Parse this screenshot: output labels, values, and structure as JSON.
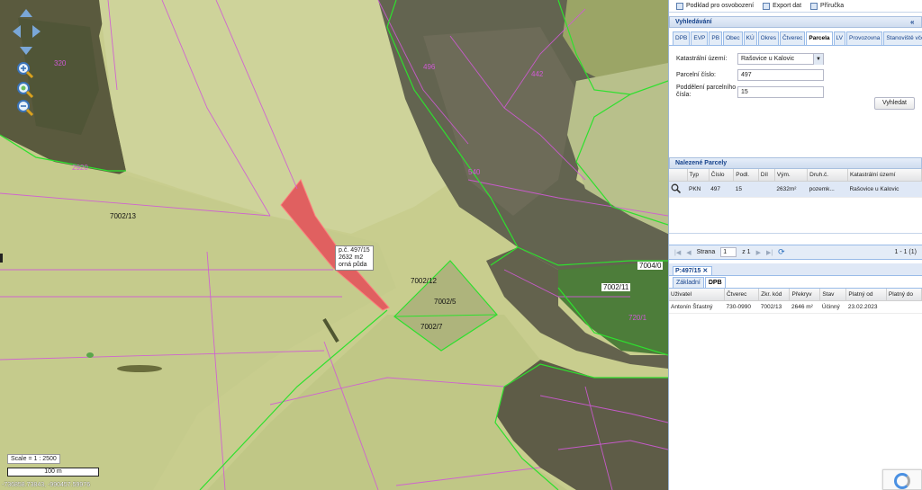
{
  "map": {
    "labels": {
      "parcel_320": "320",
      "parcel_2920": "2920",
      "parcel_7002_13": "7002/13",
      "parcel_7002_12": "7002/12",
      "parcel_7002_5": "7002/5",
      "parcel_7002_7": "7002/7",
      "parcel_7002_11": "7002/11",
      "parcel_7004_0": "7004/0",
      "parcel_496": "496",
      "parcel_442": "442",
      "parcel_540": "540",
      "parcel_720_1": "720/1"
    },
    "popup": {
      "line1": "p.č. 497/15",
      "line2": "2632 m2",
      "line3": "orná půda"
    },
    "scale_text": "Scale = 1 : 2500",
    "scale_bar_label": "100 m",
    "coords": "-736858.73843, -990457.59976"
  },
  "toolbar": {
    "podklad": "Podklad pro osvobození",
    "export": "Export dat",
    "prirucka": "Příručka"
  },
  "search": {
    "title": "Vyhledávání",
    "tabs": [
      "DPB",
      "EVP",
      "PB",
      "Obec",
      "KÚ",
      "Okres",
      "Čtverec",
      "Parcela",
      "LV",
      "Provozovna",
      "Stanoviště včel"
    ],
    "active_tab": "Parcela",
    "katastralni_label": "Katastrální území:",
    "katastralni_value": "Rašovice u Kalovic",
    "parcelni_label": "Parcelní číslo:",
    "parcelni_value": "497",
    "poddeleni_label": "Poddělení parcelního čísla:",
    "poddeleni_value": "15",
    "button": "Vyhledat"
  },
  "results": {
    "title": "Nalezené Parcely",
    "columns": [
      "Typ",
      "Číslo",
      "Podl.",
      "Díl",
      "Vým.",
      "Druh.č.",
      "Katastrální území"
    ],
    "row": {
      "typ": "PKN",
      "cislo": "497",
      "podl": "15",
      "dil": "",
      "vym": "2632m²",
      "druh": "pozemk...",
      "ku": "Rašovice u Kalovic"
    },
    "pager": {
      "strana": "Strana",
      "page": "1",
      "of": "z 1",
      "info": "1 - 1 (1)"
    }
  },
  "detail": {
    "tab_title": "P:497/15",
    "subtabs": [
      "Základní",
      "DPB"
    ],
    "active_subtab": "DPB",
    "columns": [
      "Uživatel",
      "Čtverec",
      "Zkr. kód",
      "Překryv",
      "Stav",
      "Platný od",
      "Platný do"
    ],
    "row": {
      "uzivatel": "Antonín Šťastný",
      "ctverec": "730-0990",
      "zkr": "7002/13",
      "prekryv": "2646 m²",
      "stav": "Účinný",
      "od": "23.02.2023",
      "do": ""
    }
  }
}
